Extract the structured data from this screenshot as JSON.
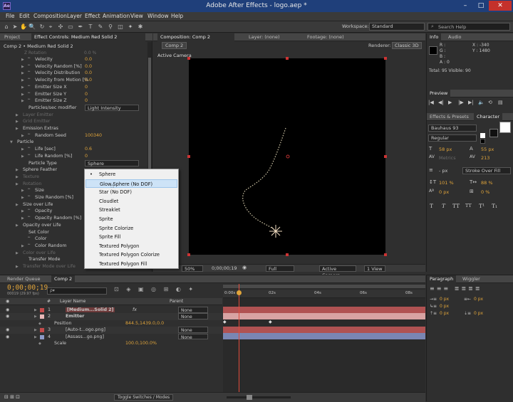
{
  "app": {
    "title": "Adobe After Effects - logo.aep *",
    "logo": "Ae"
  },
  "window_controls": {
    "minimize": "–",
    "maximize": "□",
    "close": "✕"
  },
  "menu": [
    "File",
    "Edit",
    "Composition",
    "Layer",
    "Effect",
    "Animation",
    "View",
    "Window",
    "Help"
  ],
  "toolbar": {
    "workspace_label": "Workspace:",
    "workspace_value": "Standard",
    "search_placeholder": "Search Help"
  },
  "left_panel": {
    "tab_project": "Project",
    "tab_effect_controls": "Effect Controls: Medium Red Solid 2",
    "breadcrumb": "Comp 2 • Medium Red Solid 2",
    "cutoff_top": "Z Rotation",
    "cutoff_value": "0.0 %",
    "properties": [
      {
        "indent": 2,
        "tri": "▶",
        "sw": "ᵚ",
        "label": "Velocity",
        "value": "0.0",
        "dim": false
      },
      {
        "indent": 2,
        "tri": "▶",
        "sw": "ᵚ",
        "label": "Velocity Random [%]",
        "value": "0.0",
        "dim": false
      },
      {
        "indent": 2,
        "tri": "▶",
        "sw": "ᵚ",
        "label": "Velocity Distribution",
        "value": "0.0",
        "dim": false
      },
      {
        "indent": 2,
        "tri": "▶",
        "sw": "ᵚ",
        "label": "Velocity from Motion [%",
        "value": "0.0",
        "dim": false
      },
      {
        "indent": 2,
        "tri": "▶",
        "sw": "ᵚ",
        "label": "Emitter Size X",
        "value": "0",
        "dim": false
      },
      {
        "indent": 2,
        "tri": "▶",
        "sw": "ᵚ",
        "label": "Emitter Size Y",
        "value": "0",
        "dim": false
      },
      {
        "indent": 2,
        "tri": "▶",
        "sw": "ᵚ",
        "label": "Emitter Size Z",
        "value": "0",
        "dim": false
      },
      {
        "indent": 2,
        "tri": "",
        "sw": "",
        "label": "Particles/sec modifier",
        "value": "",
        "dim": false,
        "dropdown": "Light Intensity"
      },
      {
        "indent": 1,
        "tri": "▶",
        "sw": "",
        "label": "Layer Emitter",
        "value": "",
        "dim": true
      },
      {
        "indent": 1,
        "tri": "▶",
        "sw": "",
        "label": "Grid Emitter",
        "value": "",
        "dim": true
      },
      {
        "indent": 1,
        "tri": "▶",
        "sw": "",
        "label": "Emission Extras",
        "value": "",
        "dim": false
      },
      {
        "indent": 2,
        "tri": "▶",
        "sw": "ᵚ",
        "label": "Random Seed",
        "value": "100340",
        "dim": false
      },
      {
        "indent": 0,
        "tri": "▼",
        "sw": "",
        "label": "Particle",
        "value": "",
        "dim": false
      },
      {
        "indent": 2,
        "tri": "▶",
        "sw": "ᵚ",
        "label": "Life [sec]",
        "value": "0.6",
        "dim": false
      },
      {
        "indent": 2,
        "tri": "▶",
        "sw": "ᵚ",
        "label": "Life Random [%]",
        "value": "0",
        "dim": false
      },
      {
        "indent": 2,
        "tri": "",
        "sw": "",
        "label": "Particle Type",
        "value": "",
        "dim": false,
        "dropdown": "Sphere"
      },
      {
        "indent": 1,
        "tri": "▶",
        "sw": "",
        "label": "Sphere Feather",
        "value": "",
        "dim": false
      },
      {
        "indent": 1,
        "tri": "▶",
        "sw": "",
        "label": "Texture",
        "value": "",
        "dim": true
      },
      {
        "indent": 1,
        "tri": "▶",
        "sw": "",
        "label": "Rotation",
        "value": "",
        "dim": true
      },
      {
        "indent": 2,
        "tri": "▶",
        "sw": "ᵚ",
        "label": "Size",
        "value": "",
        "dim": false
      },
      {
        "indent": 2,
        "tri": "▶",
        "sw": "ᵚ",
        "label": "Size Random [%]",
        "value": "",
        "dim": false
      },
      {
        "indent": 1,
        "tri": "▶",
        "sw": "",
        "label": "Size over Life",
        "value": "",
        "dim": false
      },
      {
        "indent": 2,
        "tri": "▶",
        "sw": "ᵚ",
        "label": "Opacity",
        "value": "",
        "dim": false
      },
      {
        "indent": 2,
        "tri": "▶",
        "sw": "ᵚ",
        "label": "Opacity Random [%]",
        "value": "",
        "dim": false
      },
      {
        "indent": 1,
        "tri": "▶",
        "sw": "",
        "label": "Opacity over Life",
        "value": "",
        "dim": false
      },
      {
        "indent": 2,
        "tri": "",
        "sw": "",
        "label": "Set Color",
        "value": "",
        "dim": false
      },
      {
        "indent": 2,
        "tri": "",
        "sw": "ᵚ",
        "label": "Color",
        "value": "",
        "dim": false
      },
      {
        "indent": 2,
        "tri": "▶",
        "sw": "ᵚ",
        "label": "Color Random",
        "value": "",
        "dim": false
      },
      {
        "indent": 1,
        "tri": "▶",
        "sw": "",
        "label": "Color over Life",
        "value": "",
        "dim": true
      },
      {
        "indent": 2,
        "tri": "",
        "sw": "",
        "label": "Transfer Mode",
        "value": "",
        "dim": false
      },
      {
        "indent": 1,
        "tri": "▶",
        "sw": "",
        "label": "Transfer Mode over Life",
        "value": "",
        "dim": true
      }
    ]
  },
  "particle_menu": {
    "items": [
      "Sphere",
      "Glow Sphere (No DOF)",
      "Star (No DOF)",
      "Cloudlet",
      "Streaklet",
      "Sprite",
      "Sprite Colorize",
      "Sprite Fill",
      "Textured Polygon",
      "Textured Polygon Colorize",
      "Textured Polygon Fill"
    ],
    "checked_index": 0,
    "highlight_index": 1
  },
  "comp_panel": {
    "tab_comp": "Composition: Comp 2",
    "tab_layer": "Layer: (none)",
    "tab_footage": "Footage: (none)",
    "comp_button": "Comp 2",
    "renderer_label": "Renderer:",
    "renderer_value": "Classic 3D",
    "camera_label": "Active Camera",
    "footer": {
      "zoom": "50%",
      "timecode": "0;00;00;19",
      "resolution": "Full",
      "camera": "Active Camera",
      "view": "1 View"
    }
  },
  "info_panel": {
    "tab_info": "Info",
    "tab_audio": "Audio",
    "rgb": [
      "R :",
      "G :",
      "B :",
      "A : 0"
    ],
    "x": "X : -340",
    "y": "Y : 1480",
    "totals": "Total: 95  Visible: 90"
  },
  "preview_panel": {
    "tab": "Preview",
    "buttons": [
      "|◀",
      "◀|",
      "▶",
      "|▶",
      "▶|",
      "🔈",
      "⟲",
      "▤"
    ]
  },
  "effects_panel": {
    "tab_effects": "Effects & Presets",
    "tab_character": "Character"
  },
  "character": {
    "font": "Bauhaus 93",
    "style": "Regular",
    "size": "58 px",
    "leading": "55 px",
    "kerning": "Metrics",
    "tracking": "213",
    "stroke": "- px",
    "stroke_type": "Stroke Over Fill",
    "vscale": "101 %",
    "hscale": "88 %",
    "baseline": "0 px",
    "tsume": "0 %",
    "format_buttons": [
      "T",
      "T",
      "TT",
      "TT",
      "T¹",
      "T₁"
    ]
  },
  "paragraph_panel": {
    "tab_paragraph": "Paragraph",
    "tab_wiggler": "Wiggler",
    "indents": [
      "0 px",
      "0 px",
      "0 px",
      "0 px",
      "0 px"
    ]
  },
  "timeline": {
    "tab_render": "Render Queue",
    "tab_comp": "Comp 2",
    "timecode": "0;00;00;19",
    "fps": "00019 (29.97 fps)",
    "search_placeholder": "ρ▾",
    "col_num": "#",
    "col_name": "Layer Name",
    "col_parent": "Parent",
    "ruler": [
      "0:00s",
      "02s",
      "04s",
      "06s",
      "08s"
    ],
    "toggle": "Toggle Switches / Modes",
    "layers": [
      {
        "num": "1",
        "name": "[Medium...Solid 2]",
        "color": "#c24b4b",
        "parent": "None",
        "fx": true,
        "bold": true
      },
      {
        "num": "2",
        "name": "Emitter",
        "color": "#e8b7b7",
        "parent": "None",
        "fx": false,
        "bold": true
      },
      {
        "num": "",
        "name": "Position",
        "color": "",
        "parent": "",
        "value": "844.5,1439.0,0.0",
        "sub": true
      },
      {
        "num": "3",
        "name": "[Auto-t...ogo.png]",
        "color": "#c24b4b",
        "parent": "None",
        "fx": false,
        "bold": false
      },
      {
        "num": "4",
        "name": "[Assass...go.png]",
        "color": "#8d9ac7",
        "parent": "None",
        "fx": false,
        "bold": false
      },
      {
        "num": "",
        "name": "Scale",
        "color": "",
        "parent": "",
        "value": "100.0,100.0%",
        "sub": true
      }
    ]
  }
}
